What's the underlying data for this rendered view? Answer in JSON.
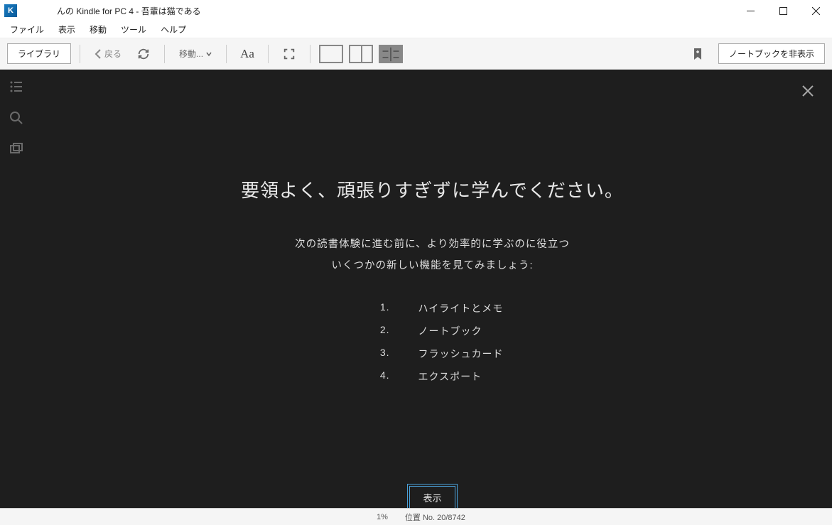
{
  "titlebar": {
    "title": "んの Kindle for PC 4 - 吾輩は猫である"
  },
  "menubar": {
    "file": "ファイル",
    "view": "表示",
    "goto": "移動",
    "tools": "ツール",
    "help": "ヘルプ"
  },
  "toolbar": {
    "library": "ライブラリ",
    "back": "戻る",
    "goto_label": "移動...",
    "notebook_toggle": "ノートブックを非表示"
  },
  "overlay": {
    "title": "要領よく、頑張りすぎずに学んでください。",
    "desc_line1": "次の読書体験に進む前に、より効率的に学ぶのに役立つ",
    "desc_line2": "いくつかの新しい機能を見てみましょう:",
    "features": [
      {
        "num": "1.",
        "label": "ハイライトとメモ"
      },
      {
        "num": "2.",
        "label": "ノートブック"
      },
      {
        "num": "3.",
        "label": "フラッシュカード"
      },
      {
        "num": "4.",
        "label": "エクスポート"
      }
    ],
    "button": "表示"
  },
  "statusbar": {
    "percent": "1%",
    "position": "位置 No. 20/8742"
  }
}
